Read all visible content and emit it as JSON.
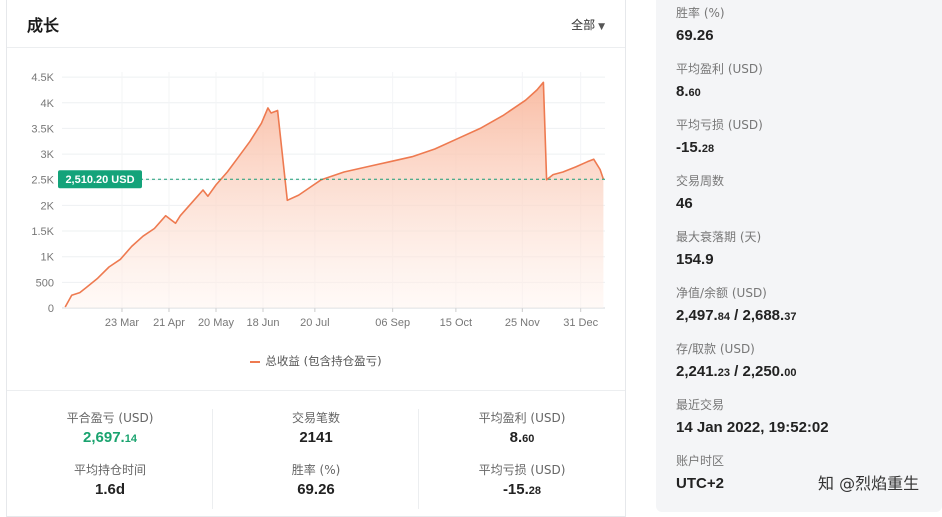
{
  "card": {
    "title": "成长",
    "range_label": "全部"
  },
  "chart_data": {
    "type": "area",
    "series": [
      {
        "name": "总收益 (包含持仓盈亏)",
        "color": "#ee7a50",
        "x": [
          "2021-02-16",
          "2021-02-20",
          "2021-02-25",
          "2021-03-01",
          "2021-03-08",
          "2021-03-15",
          "2021-03-22",
          "2021-03-29",
          "2021-04-05",
          "2021-04-12",
          "2021-04-19",
          "2021-04-25",
          "2021-04-28",
          "2021-05-05",
          "2021-05-12",
          "2021-05-15",
          "2021-05-20",
          "2021-05-27",
          "2021-06-03",
          "2021-06-10",
          "2021-06-17",
          "2021-06-21",
          "2021-06-23",
          "2021-06-27",
          "2021-07-03",
          "2021-07-10",
          "2021-07-17",
          "2021-07-24",
          "2021-08-07",
          "2021-08-21",
          "2021-09-04",
          "2021-09-18",
          "2021-10-02",
          "2021-10-16",
          "2021-10-30",
          "2021-11-13",
          "2021-11-27",
          "2021-12-04",
          "2021-12-08",
          "2021-12-10",
          "2021-12-14",
          "2021-12-20",
          "2021-12-28",
          "2022-01-04",
          "2022-01-08",
          "2022-01-12",
          "2022-01-14"
        ],
        "y": [
          20,
          250,
          300,
          400,
          580,
          800,
          950,
          1200,
          1400,
          1550,
          1800,
          1650,
          1800,
          2050,
          2300,
          2180,
          2400,
          2650,
          2950,
          3250,
          3600,
          3900,
          3800,
          3850,
          2100,
          2200,
          2350,
          2500,
          2650,
          2750,
          2850,
          2950,
          3100,
          3300,
          3500,
          3750,
          4050,
          4250,
          4400,
          2500,
          2600,
          2650,
          2750,
          2850,
          2900,
          2700,
          2510
        ]
      }
    ],
    "current_marker": {
      "value": 2510.2,
      "label": "2,510.20 USD"
    },
    "x_ticks": [
      "2021-03-23",
      "2021-04-21",
      "2021-05-20",
      "2021-06-18",
      "2021-07-20",
      "2021-09-06",
      "2021-10-15",
      "2021-11-25",
      "2021-12-31"
    ],
    "x_tick_labels": [
      "23 Mar",
      "21 Apr",
      "20 May",
      "18 Jun",
      "20 Jul",
      "06 Sep",
      "15 Oct",
      "25 Nov",
      "31 Dec"
    ],
    "y_ticks": [
      0,
      500,
      1000,
      1500,
      2000,
      2500,
      3000,
      3500,
      4000,
      4500
    ],
    "y_tick_labels": [
      "0",
      "500",
      "1K",
      "1.5K",
      "2K",
      "2.5K",
      "3K",
      "3.5K",
      "4K",
      "4.5K"
    ],
    "ylim": [
      0,
      4600
    ],
    "xlim": [
      "2021-02-14",
      "2022-01-15"
    ],
    "grid": true,
    "legend_position": "bottom",
    "fill_gradient": [
      "#f8b59a",
      "#fff4ef"
    ]
  },
  "stats": {
    "closed_pl": {
      "label": "平合盈亏 (USD)",
      "int": "2,697.",
      "dec": "14",
      "color": "#1aa36f"
    },
    "trades": {
      "label": "交易笔数",
      "value": "2141"
    },
    "avg_profit": {
      "label": "平均盈利 (USD)",
      "int": "8.",
      "dec": "60"
    },
    "avg_hold": {
      "label": "平均持仓时间",
      "value": "1.6d"
    },
    "win_rate": {
      "label": "胜率 (%)",
      "value": "69.26"
    },
    "avg_loss": {
      "label": "平均亏损 (USD)",
      "int": "-15.",
      "dec": "28"
    }
  },
  "side": {
    "win_rate": {
      "label": "胜率 (%)",
      "value": "69.26"
    },
    "avg_profit": {
      "label": "平均盈利 (USD)",
      "int": "8.",
      "dec": "60"
    },
    "avg_loss": {
      "label": "平均亏损 (USD)",
      "int": "-15.",
      "dec": "28"
    },
    "weeks": {
      "label": "交易周数",
      "value": "46"
    },
    "max_drawdown": {
      "label": "最大衰落期 (天)",
      "value": "154.9"
    },
    "equity_balance": {
      "label": "净值/余额 (USD)",
      "a_int": "2,497.",
      "a_dec": "84",
      "sep": " / ",
      "b_int": "2,688.",
      "b_dec": "37"
    },
    "deposit_withdraw": {
      "label": "存/取款 (USD)",
      "a_int": "2,241.",
      "a_dec": "23",
      "sep": " / ",
      "b_int": "2,250.",
      "b_dec": "00"
    },
    "last_trade": {
      "label": "最近交易",
      "value": "14 Jan 2022, 19:52:02"
    },
    "timezone": {
      "label": "账户时区",
      "value": "UTC+2"
    }
  },
  "watermark": {
    "text": "知 @烈焰重生"
  }
}
